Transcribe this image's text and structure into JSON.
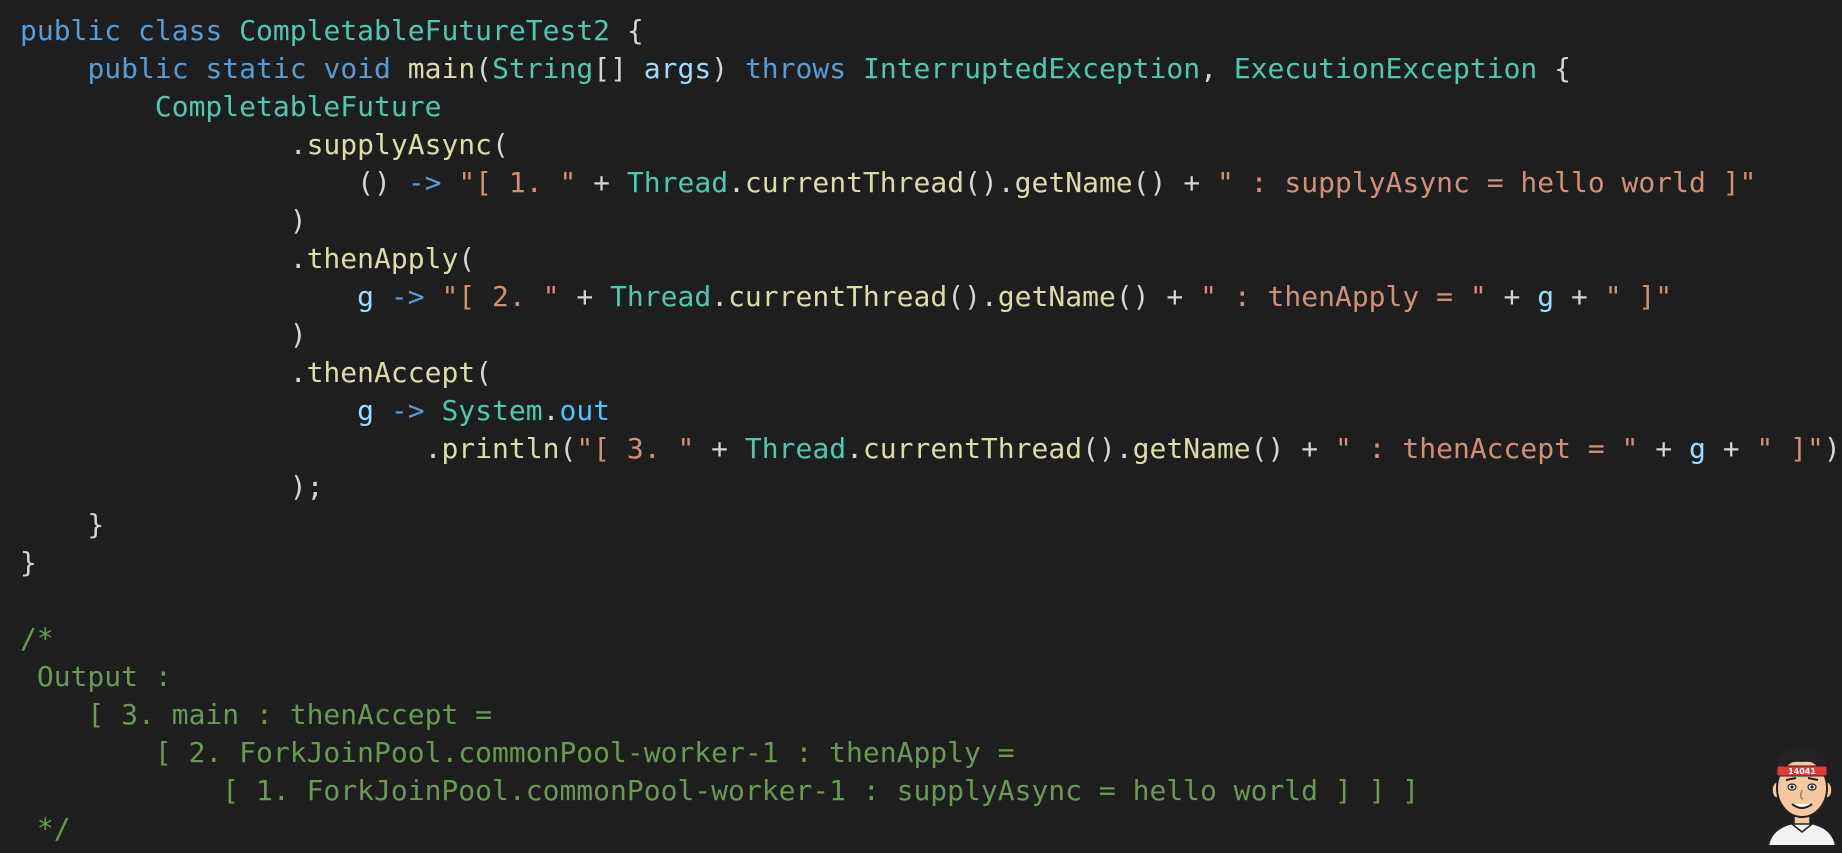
{
  "colors": {
    "background": "#1e1e1e",
    "keyword": "#569cd6",
    "type": "#4ec9b0",
    "method": "#dcdcaa",
    "string": "#ce9178",
    "variable": "#9cdcfe",
    "field": "#4fc1ff",
    "punctuation": "#d4d4d4",
    "comment": "#6a9955"
  },
  "code_lines": [
    [
      {
        "t": "public",
        "k": "keyword"
      },
      {
        "t": " ",
        "k": "punct"
      },
      {
        "t": "class",
        "k": "keyword"
      },
      {
        "t": " ",
        "k": "punct"
      },
      {
        "t": "CompletableFutureTest2",
        "k": "type"
      },
      {
        "t": " {",
        "k": "punct"
      }
    ],
    [
      {
        "t": "    ",
        "k": "punct"
      },
      {
        "t": "public",
        "k": "keyword"
      },
      {
        "t": " ",
        "k": "punct"
      },
      {
        "t": "static",
        "k": "keyword"
      },
      {
        "t": " ",
        "k": "punct"
      },
      {
        "t": "void",
        "k": "keyword"
      },
      {
        "t": " ",
        "k": "punct"
      },
      {
        "t": "main",
        "k": "method"
      },
      {
        "t": "(",
        "k": "punct"
      },
      {
        "t": "String",
        "k": "type"
      },
      {
        "t": "[] ",
        "k": "punct"
      },
      {
        "t": "args",
        "k": "var"
      },
      {
        "t": ") ",
        "k": "punct"
      },
      {
        "t": "throws",
        "k": "keyword"
      },
      {
        "t": " ",
        "k": "punct"
      },
      {
        "t": "InterruptedException",
        "k": "type"
      },
      {
        "t": ", ",
        "k": "punct"
      },
      {
        "t": "ExecutionException",
        "k": "type"
      },
      {
        "t": " {",
        "k": "punct"
      }
    ],
    [
      {
        "t": "        ",
        "k": "punct"
      },
      {
        "t": "CompletableFuture",
        "k": "type"
      }
    ],
    [
      {
        "t": "                .",
        "k": "punct"
      },
      {
        "t": "supplyAsync",
        "k": "method"
      },
      {
        "t": "(",
        "k": "punct"
      }
    ],
    [
      {
        "t": "                    () ",
        "k": "punct"
      },
      {
        "t": "->",
        "k": "keyword"
      },
      {
        "t": " ",
        "k": "punct"
      },
      {
        "t": "\"[ 1. \"",
        "k": "string"
      },
      {
        "t": " + ",
        "k": "punct"
      },
      {
        "t": "Thread",
        "k": "type"
      },
      {
        "t": ".",
        "k": "punct"
      },
      {
        "t": "currentThread",
        "k": "method"
      },
      {
        "t": "().",
        "k": "punct"
      },
      {
        "t": "getName",
        "k": "method"
      },
      {
        "t": "() + ",
        "k": "punct"
      },
      {
        "t": "\" : supplyAsync = hello world ]\"",
        "k": "string"
      }
    ],
    [
      {
        "t": "                )",
        "k": "punct"
      }
    ],
    [
      {
        "t": "                .",
        "k": "punct"
      },
      {
        "t": "thenApply",
        "k": "method"
      },
      {
        "t": "(",
        "k": "punct"
      }
    ],
    [
      {
        "t": "                    ",
        "k": "punct"
      },
      {
        "t": "g",
        "k": "var"
      },
      {
        "t": " ",
        "k": "punct"
      },
      {
        "t": "->",
        "k": "keyword"
      },
      {
        "t": " ",
        "k": "punct"
      },
      {
        "t": "\"[ 2. \"",
        "k": "string"
      },
      {
        "t": " + ",
        "k": "punct"
      },
      {
        "t": "Thread",
        "k": "type"
      },
      {
        "t": ".",
        "k": "punct"
      },
      {
        "t": "currentThread",
        "k": "method"
      },
      {
        "t": "().",
        "k": "punct"
      },
      {
        "t": "getName",
        "k": "method"
      },
      {
        "t": "() + ",
        "k": "punct"
      },
      {
        "t": "\" : thenApply = \"",
        "k": "string"
      },
      {
        "t": " + ",
        "k": "punct"
      },
      {
        "t": "g",
        "k": "var"
      },
      {
        "t": " + ",
        "k": "punct"
      },
      {
        "t": "\" ]\"",
        "k": "string"
      }
    ],
    [
      {
        "t": "                )",
        "k": "punct"
      }
    ],
    [
      {
        "t": "                .",
        "k": "punct"
      },
      {
        "t": "thenAccept",
        "k": "method"
      },
      {
        "t": "(",
        "k": "punct"
      }
    ],
    [
      {
        "t": "                    ",
        "k": "punct"
      },
      {
        "t": "g",
        "k": "var"
      },
      {
        "t": " ",
        "k": "punct"
      },
      {
        "t": "->",
        "k": "keyword"
      },
      {
        "t": " ",
        "k": "punct"
      },
      {
        "t": "System",
        "k": "type"
      },
      {
        "t": ".",
        "k": "punct"
      },
      {
        "t": "out",
        "k": "field"
      }
    ],
    [
      {
        "t": "                        .",
        "k": "punct"
      },
      {
        "t": "println",
        "k": "method"
      },
      {
        "t": "(",
        "k": "punct"
      },
      {
        "t": "\"[ 3. \"",
        "k": "string"
      },
      {
        "t": " + ",
        "k": "punct"
      },
      {
        "t": "Thread",
        "k": "type"
      },
      {
        "t": ".",
        "k": "punct"
      },
      {
        "t": "currentThread",
        "k": "method"
      },
      {
        "t": "().",
        "k": "punct"
      },
      {
        "t": "getName",
        "k": "method"
      },
      {
        "t": "() + ",
        "k": "punct"
      },
      {
        "t": "\" : thenAccept = \"",
        "k": "string"
      },
      {
        "t": " + ",
        "k": "punct"
      },
      {
        "t": "g",
        "k": "var"
      },
      {
        "t": " + ",
        "k": "punct"
      },
      {
        "t": "\" ]\"",
        "k": "string"
      },
      {
        "t": ")",
        "k": "punct"
      }
    ],
    [
      {
        "t": "                );",
        "k": "punct"
      }
    ],
    [
      {
        "t": "    }",
        "k": "punct"
      }
    ],
    [
      {
        "t": "}",
        "k": "punct"
      }
    ],
    [],
    [
      {
        "t": "/*",
        "k": "comment"
      }
    ],
    [
      {
        "t": " Output :",
        "k": "comment"
      }
    ],
    [
      {
        "t": "    [ 3. main : thenAccept =",
        "k": "comment"
      }
    ],
    [
      {
        "t": "        [ 2. ForkJoinPool.commonPool-worker-1 : thenApply =",
        "k": "comment"
      }
    ],
    [
      {
        "t": "            [ 1. ForkJoinPool.commonPool-worker-1 : supplyAsync = hello world ] ] ]",
        "k": "comment"
      }
    ],
    [
      {
        "t": " */",
        "k": "comment"
      }
    ]
  ],
  "avatar": {
    "icon": "cartoon-avatar-icon",
    "headband_text": "14041",
    "headband_color": "#e53935"
  }
}
